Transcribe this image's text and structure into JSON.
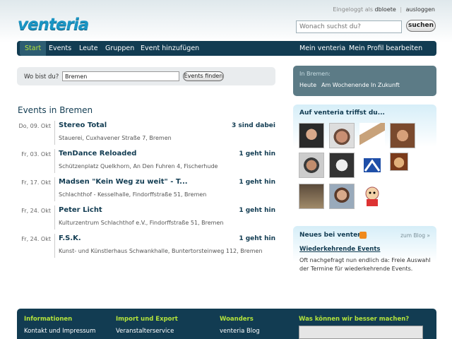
{
  "header": {
    "logged_in_label": "Eingeloggt als",
    "username": "dbloete",
    "separator": "|",
    "logout": "ausloggen",
    "logo": "venteria",
    "search_placeholder": "Wonach suchst du?",
    "search_button": "suchen"
  },
  "nav": {
    "items": [
      "Start",
      "Events",
      "Leute",
      "Gruppen",
      "Event hinzufügen"
    ],
    "right_items": [
      "Mein venteria",
      "Mein Profil bearbeiten"
    ]
  },
  "location": {
    "label": "Wo bist du?",
    "value": "Bremen",
    "button": "Events finden"
  },
  "events": {
    "title": "Events in Bremen",
    "items": [
      {
        "date": "Do, 09. Okt",
        "name": "Stereo Total",
        "place": "Stauerei, Cuxhavener Straße 7, Bremen",
        "attend": "3 sind dabei"
      },
      {
        "date": "Fr, 03. Okt",
        "name": "TenDance Reloaded",
        "place": "Schützenplatz Quelkhorn, An Den Fuhren 4, Fischerhude",
        "attend": "1 geht hin"
      },
      {
        "date": "Fr, 17. Okt",
        "name": "Madsen \"Kein Weg zu weit\" - T...",
        "place": "Schlachthof - Kesselhalle, Findorffstraße 51, Bremen",
        "attend": "1 geht hin"
      },
      {
        "date": "Fr, 24. Okt",
        "name": "Peter Licht",
        "place": "Kulturzentrum Schlachthof e.V., Findorffstraße 51, Bremen",
        "attend": "1 geht hin"
      },
      {
        "date": "Fr, 24. Okt",
        "name": "F.S.K.",
        "place": "Kunst- und Künstlerhaus Schwankhalle, Buntertorsteinweg 112, Bremen",
        "attend": "1 geht hin"
      }
    ]
  },
  "in_city": {
    "heading": "In Bremen:",
    "links": [
      "Heute",
      "Am Wochenende",
      "In Zukunft"
    ]
  },
  "meet": {
    "heading": "Auf venteria triffst du..."
  },
  "news": {
    "heading": "Neues bei venteria",
    "blog_link": "zum Blog »",
    "title": "Wiederkehrende Events",
    "text": "Oft nachgefragt nun endlich da: Freie Auswahl der Termine für wiederkehrende Events."
  },
  "footer": {
    "columns": [
      {
        "title": "Informationen",
        "link": "Kontakt und Impressum"
      },
      {
        "title": "Import und Export",
        "link": "Veranstalterservice"
      },
      {
        "title": "Woanders",
        "link": "venteria Blog"
      },
      {
        "title": "Was können wir besser machen?",
        "link": ""
      }
    ]
  },
  "colors": {
    "nav_bg": "#123c52",
    "accent_green": "#b5e53b",
    "logo_blue": "#1a95c4"
  }
}
